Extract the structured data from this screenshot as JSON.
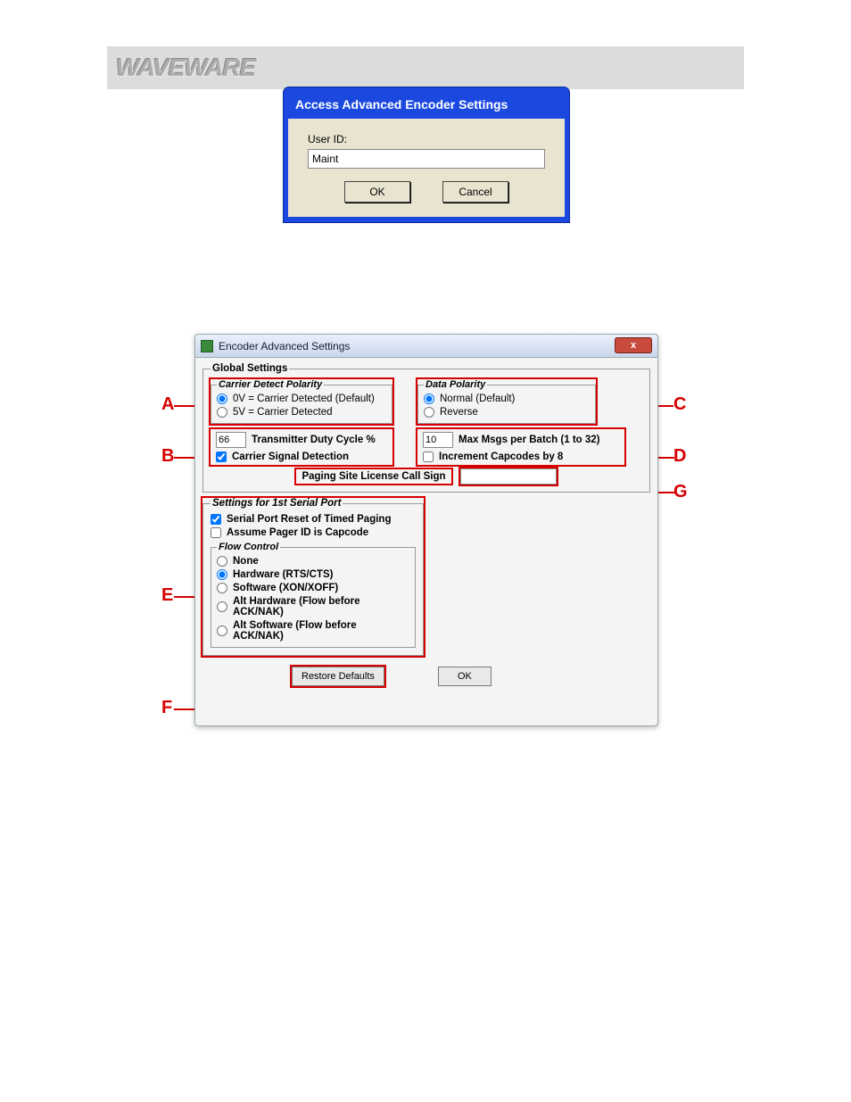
{
  "header": {
    "brand": "WAVEWARE"
  },
  "dialog_access": {
    "title": "Access Advanced Encoder Settings",
    "user_id_label": "User ID:",
    "user_id_value": "Maint",
    "ok": "OK",
    "cancel": "Cancel"
  },
  "dialog_advanced": {
    "title": "Encoder Advanced Settings",
    "close": "x",
    "global_legend": "Global Settings",
    "carrier_detect": {
      "legend": "Carrier Detect Polarity",
      "opt_0v": "0V = Carrier Detected (Default)",
      "opt_5v": "5V = Carrier Detected",
      "selected": "0v"
    },
    "data_polarity": {
      "legend": "Data Polarity",
      "opt_normal": "Normal (Default)",
      "opt_reverse": "Reverse",
      "selected": "normal"
    },
    "duty_cycle": {
      "value": "66",
      "label": "Transmitter Duty Cycle %"
    },
    "carrier_signal_detection": {
      "checked": true,
      "label": "Carrier Signal Detection"
    },
    "max_msgs": {
      "value": "10",
      "label": "Max Msgs per Batch (1 to 32)"
    },
    "increment_capcodes": {
      "checked": false,
      "label": "Increment Capcodes by 8"
    },
    "call_sign": {
      "label": "Paging Site License Call Sign",
      "value": ""
    },
    "serial_port": {
      "legend": "Settings for 1st Serial Port",
      "reset_timed": {
        "checked": true,
        "label": "Serial Port Reset of Timed Paging"
      },
      "assume_capcode": {
        "checked": false,
        "label": "Assume Pager ID is Capcode"
      },
      "flow_legend": "Flow Control",
      "flow_options": {
        "none": "None",
        "hardware": "Hardware (RTS/CTS)",
        "software": "Software (XON/XOFF)",
        "alt_hardware": "Alt Hardware (Flow before ACK/NAK)",
        "alt_software": "Alt Software (Flow before ACK/NAK)",
        "selected": "hardware"
      }
    },
    "restore_defaults": "Restore Defaults",
    "ok": "OK"
  },
  "callouts": {
    "A": "A",
    "B": "B",
    "C": "C",
    "D": "D",
    "E": "E",
    "F": "F",
    "G": "G"
  }
}
